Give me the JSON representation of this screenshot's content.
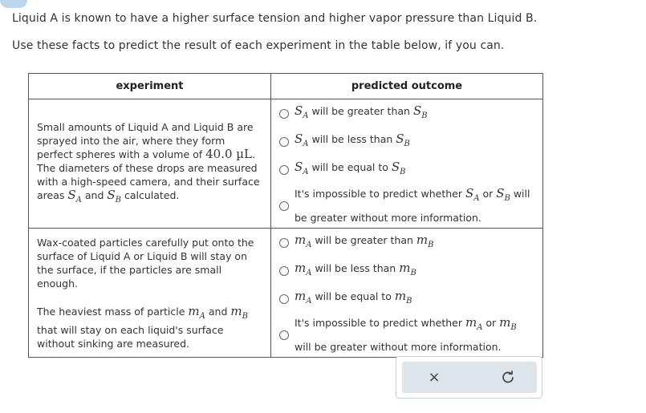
{
  "intro": {
    "line1": "Liquid A is known to have a higher surface tension and higher vapor pressure than Liquid B.",
    "line2": "Use these facts to predict the result of each experiment in the table below, if you can."
  },
  "table": {
    "header_experiment": "experiment",
    "header_outcome": "predicted outcome",
    "row1": {
      "desc_a": "Small amounts of Liquid A and Liquid B are sprayed into the air, where they form perfect spheres with a volume of ",
      "volume": "40.0 µL",
      "desc_b": ". The diameters of these drops are measured with a high-speed camera, and their surface areas ",
      "sym_a": "S",
      "sub_a": "A",
      "and": " and ",
      "sym_b": "S",
      "sub_b": "B",
      "desc_c": " calculated.",
      "options": [
        {
          "pre": "",
          "mid": " will be greater than ",
          "post": ""
        },
        {
          "pre": "",
          "mid": " will be less than ",
          "post": ""
        },
        {
          "pre": "",
          "mid": " will be equal to ",
          "post": ""
        }
      ],
      "impossible_pre": "It's impossible to predict whether ",
      "impossible_or": " or ",
      "impossible_post": " will be greater without more information."
    },
    "row2": {
      "desc_a": "Wax-coated particles carefully put onto the surface of Liquid A or Liquid B will stay on the surface, if the particles are small enough.",
      "desc_b": "The heaviest mass of particle ",
      "sym_a": "m",
      "sub_a": "A",
      "and": " and ",
      "sym_b": "m",
      "sub_b": "B",
      "desc_c": " that will stay on each liquid's surface without sinking are measured.",
      "options": [
        {
          "mid": " will be greater than "
        },
        {
          "mid": " will be less than "
        },
        {
          "mid": " will be equal to "
        }
      ],
      "impossible_pre": "It's impossible to predict whether ",
      "impossible_or": " or ",
      "impossible_post": " will be greater without more information."
    }
  },
  "actions": {
    "clear_icon": "×",
    "retry_icon": "retry-icon"
  }
}
